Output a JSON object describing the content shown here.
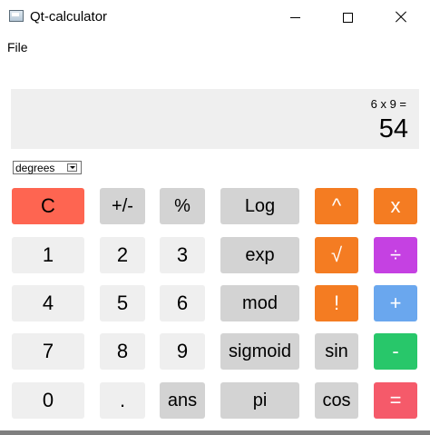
{
  "window": {
    "title": "Qt-calculator"
  },
  "menu": {
    "file": "File"
  },
  "display": {
    "expression": "6 x 9 =",
    "result": "54"
  },
  "mode": {
    "selected": "degrees"
  },
  "keys": {
    "clear": "C",
    "sign": "+/-",
    "percent": "%",
    "log": "Log",
    "power": "^",
    "multiply": "x",
    "d1": "1",
    "d2": "2",
    "d3": "3",
    "exp": "exp",
    "sqrt": "√",
    "divide": "÷",
    "d4": "4",
    "d5": "5",
    "d6": "6",
    "mod": "mod",
    "factorial": "!",
    "add": "+",
    "d7": "7",
    "d8": "8",
    "d9": "9",
    "sigmoid": "sigmoid",
    "sin": "sin",
    "subtract": "-",
    "d0": "0",
    "dot": ".",
    "ans": "ans",
    "pi": "pi",
    "cos": "cos",
    "equals": "="
  },
  "colors": {
    "clear": "#fe6551",
    "operator": "#f47c22",
    "divide": "#c541e2",
    "add": "#6aa7ee",
    "subtract": "#28c76a",
    "equals": "#f55a6a"
  }
}
